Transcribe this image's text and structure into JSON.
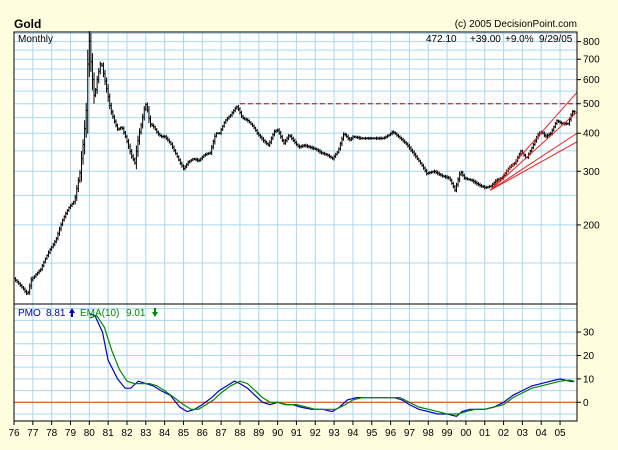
{
  "chart_data": [
    {
      "type": "bar",
      "subtype": "ohlc-monthly",
      "title": "Gold",
      "subtitle": "Monthly",
      "credit": "(c) 2005 DecisionPoint.com",
      "readout": {
        "last": "472.10",
        "change": "+39.00",
        "pct": "+9.0%",
        "date": "9/29/05"
      },
      "x_range": [
        1976,
        2005.9
      ],
      "ylim": [
        110,
        860
      ],
      "y_log": true,
      "y_ticks": [
        200,
        300,
        400,
        500,
        600,
        700,
        800
      ],
      "y_tick_labels": [
        "200",
        "300",
        "400",
        "500",
        "600",
        "700",
        "800"
      ],
      "x_tick_labels": [
        "76",
        "77",
        "78",
        "79",
        "80",
        "81",
        "82",
        "83",
        "84",
        "85",
        "86",
        "87",
        "88",
        "89",
        "90",
        "91",
        "92",
        "93",
        "94",
        "95",
        "96",
        "97",
        "98",
        "99",
        "00",
        "01",
        "02",
        "03",
        "04",
        "05"
      ],
      "grid": true,
      "price_path": [
        [
          1976.0,
          135
        ],
        [
          1976.5,
          125
        ],
        [
          1976.8,
          118
        ],
        [
          1977.0,
          132
        ],
        [
          1977.5,
          143
        ],
        [
          1977.9,
          162
        ],
        [
          1978.3,
          178
        ],
        [
          1978.7,
          210
        ],
        [
          1979.0,
          228
        ],
        [
          1979.3,
          240
        ],
        [
          1979.6,
          300
        ],
        [
          1979.8,
          390
        ],
        [
          1979.95,
          500
        ],
        [
          1980.05,
          850
        ],
        [
          1980.2,
          640
        ],
        [
          1980.35,
          520
        ],
        [
          1980.5,
          600
        ],
        [
          1980.7,
          690
        ],
        [
          1980.85,
          620
        ],
        [
          1981.0,
          560
        ],
        [
          1981.2,
          480
        ],
        [
          1981.4,
          440
        ],
        [
          1981.6,
          410
        ],
        [
          1981.8,
          420
        ],
        [
          1982.0,
          390
        ],
        [
          1982.3,
          340
        ],
        [
          1982.5,
          320
        ],
        [
          1982.7,
          390
        ],
        [
          1982.85,
          430
        ],
        [
          1983.0,
          480
        ],
        [
          1983.1,
          500
        ],
        [
          1983.3,
          430
        ],
        [
          1983.5,
          420
        ],
        [
          1983.7,
          400
        ],
        [
          1983.9,
          390
        ],
        [
          1984.1,
          390
        ],
        [
          1984.4,
          370
        ],
        [
          1984.7,
          340
        ],
        [
          1984.9,
          320
        ],
        [
          1985.1,
          305
        ],
        [
          1985.3,
          320
        ],
        [
          1985.6,
          330
        ],
        [
          1985.9,
          325
        ],
        [
          1986.2,
          340
        ],
        [
          1986.5,
          345
        ],
        [
          1986.8,
          400
        ],
        [
          1987.0,
          400
        ],
        [
          1987.3,
          440
        ],
        [
          1987.6,
          460
        ],
        [
          1987.9,
          490
        ],
        [
          1988.0,
          480
        ],
        [
          1988.2,
          450
        ],
        [
          1988.5,
          440
        ],
        [
          1988.8,
          420
        ],
        [
          1989.0,
          400
        ],
        [
          1989.3,
          380
        ],
        [
          1989.6,
          365
        ],
        [
          1989.9,
          405
        ],
        [
          1990.1,
          410
        ],
        [
          1990.4,
          370
        ],
        [
          1990.7,
          395
        ],
        [
          1990.9,
          380
        ],
        [
          1991.2,
          360
        ],
        [
          1991.5,
          365
        ],
        [
          1991.8,
          360
        ],
        [
          1992.1,
          355
        ],
        [
          1992.4,
          345
        ],
        [
          1992.7,
          340
        ],
        [
          1993.0,
          330
        ],
        [
          1993.3,
          350
        ],
        [
          1993.6,
          400
        ],
        [
          1993.9,
          380
        ],
        [
          1994.1,
          390
        ],
        [
          1994.5,
          385
        ],
        [
          1994.9,
          385
        ],
        [
          1995.3,
          385
        ],
        [
          1995.7,
          385
        ],
        [
          1996.0,
          395
        ],
        [
          1996.2,
          405
        ],
        [
          1996.6,
          385
        ],
        [
          1996.9,
          370
        ],
        [
          1997.2,
          350
        ],
        [
          1997.5,
          330
        ],
        [
          1997.8,
          310
        ],
        [
          1998.0,
          295
        ],
        [
          1998.4,
          300
        ],
        [
          1998.8,
          290
        ],
        [
          1999.2,
          285
        ],
        [
          1999.5,
          260
        ],
        [
          1999.8,
          300
        ],
        [
          2000.0,
          285
        ],
        [
          2000.4,
          280
        ],
        [
          2000.8,
          270
        ],
        [
          2001.1,
          265
        ],
        [
          2001.4,
          268
        ],
        [
          2001.7,
          280
        ],
        [
          2002.0,
          285
        ],
        [
          2002.4,
          310
        ],
        [
          2002.7,
          320
        ],
        [
          2003.0,
          350
        ],
        [
          2003.3,
          330
        ],
        [
          2003.6,
          360
        ],
        [
          2003.9,
          395
        ],
        [
          2004.1,
          405
        ],
        [
          2004.3,
          390
        ],
        [
          2004.6,
          400
        ],
        [
          2004.9,
          440
        ],
        [
          2005.2,
          430
        ],
        [
          2005.5,
          430
        ],
        [
          2005.75,
          472
        ]
      ],
      "annotations": {
        "resistance_level": 500,
        "resistance_start_x": 1988.0,
        "trendlines": [
          {
            "points": [
              [
                2001.3,
                260
              ],
              [
                2005.9,
                545
              ]
            ]
          },
          {
            "points": [
              [
                2001.3,
                260
              ],
              [
                2005.9,
                470
              ]
            ]
          },
          {
            "points": [
              [
                2001.3,
                260
              ],
              [
                2005.9,
                400
              ]
            ]
          },
          {
            "points": [
              [
                2001.3,
                260
              ],
              [
                2005.9,
                375
              ]
            ]
          }
        ]
      },
      "colors": {
        "price": "#000000",
        "resistance": "#CC0000",
        "trend": "#EE2222",
        "grid": "#A8D8F0",
        "background": "#FFFFFF"
      }
    },
    {
      "type": "line",
      "subtitle_parts": {
        "pmo": "PMO",
        "pmo_value": "8.81",
        "ema": "EMA(10)",
        "ema_value": "9.01"
      },
      "arrows": {
        "pmo": "up",
        "ema": "down"
      },
      "ylim": [
        -8,
        42
      ],
      "y_ticks": [
        0,
        10,
        20,
        30
      ],
      "y_tick_labels": [
        "0",
        "10",
        "20",
        "30"
      ],
      "zero_line": 0,
      "series": [
        {
          "name": "PMO",
          "color": "#0000CC",
          "points": [
            [
              1980.0,
              38
            ],
            [
              1980.3,
              37
            ],
            [
              1980.7,
              30
            ],
            [
              1981.0,
              18
            ],
            [
              1981.5,
              10
            ],
            [
              1981.9,
              6
            ],
            [
              1982.2,
              6
            ],
            [
              1982.6,
              9
            ],
            [
              1983.0,
              8
            ],
            [
              1983.4,
              7
            ],
            [
              1983.8,
              5
            ],
            [
              1984.3,
              3
            ],
            [
              1984.8,
              -2
            ],
            [
              1985.2,
              -4
            ],
            [
              1985.6,
              -3
            ],
            [
              1986.0,
              -1
            ],
            [
              1986.5,
              2
            ],
            [
              1986.9,
              5
            ],
            [
              1987.3,
              7
            ],
            [
              1987.7,
              9
            ],
            [
              1988.0,
              8
            ],
            [
              1988.4,
              6
            ],
            [
              1988.8,
              3
            ],
            [
              1989.2,
              0
            ],
            [
              1989.6,
              -1
            ],
            [
              1990.0,
              0
            ],
            [
              1990.4,
              -1
            ],
            [
              1990.8,
              -1
            ],
            [
              1991.2,
              -2
            ],
            [
              1991.8,
              -3
            ],
            [
              1992.4,
              -3
            ],
            [
              1992.9,
              -4
            ],
            [
              1993.3,
              -2
            ],
            [
              1993.7,
              1
            ],
            [
              1994.2,
              2
            ],
            [
              1994.7,
              2
            ],
            [
              1995.2,
              2
            ],
            [
              1995.7,
              2
            ],
            [
              1996.2,
              2
            ],
            [
              1996.6,
              1
            ],
            [
              1997.0,
              -1
            ],
            [
              1997.5,
              -3
            ],
            [
              1998.0,
              -4
            ],
            [
              1998.5,
              -5
            ],
            [
              1999.0,
              -5
            ],
            [
              1999.5,
              -6
            ],
            [
              1999.8,
              -4
            ],
            [
              2000.2,
              -3
            ],
            [
              2000.6,
              -3
            ],
            [
              2001.0,
              -3
            ],
            [
              2001.5,
              -2
            ],
            [
              2002.0,
              0
            ],
            [
              2002.5,
              3
            ],
            [
              2003.0,
              5
            ],
            [
              2003.5,
              7
            ],
            [
              2004.0,
              8
            ],
            [
              2004.5,
              9
            ],
            [
              2005.0,
              10
            ],
            [
              2005.5,
              9
            ],
            [
              2005.75,
              8.81
            ]
          ]
        },
        {
          "name": "EMA(10)",
          "color": "#008800",
          "points": [
            [
              1980.0,
              36
            ],
            [
              1980.4,
              37
            ],
            [
              1980.8,
              32
            ],
            [
              1981.2,
              22
            ],
            [
              1981.6,
              14
            ],
            [
              1982.0,
              9
            ],
            [
              1982.4,
              8
            ],
            [
              1982.8,
              8
            ],
            [
              1983.2,
              8
            ],
            [
              1983.6,
              7
            ],
            [
              1984.0,
              5
            ],
            [
              1984.5,
              2
            ],
            [
              1985.0,
              -1
            ],
            [
              1985.4,
              -3
            ],
            [
              1985.8,
              -3
            ],
            [
              1986.2,
              -1
            ],
            [
              1986.6,
              1
            ],
            [
              1987.0,
              4
            ],
            [
              1987.5,
              7
            ],
            [
              1988.0,
              9
            ],
            [
              1988.4,
              8
            ],
            [
              1988.8,
              5
            ],
            [
              1989.2,
              2
            ],
            [
              1989.6,
              0
            ],
            [
              1990.0,
              0
            ],
            [
              1990.5,
              -1
            ],
            [
              1991.0,
              -1
            ],
            [
              1991.5,
              -2
            ],
            [
              1992.0,
              -3
            ],
            [
              1992.6,
              -3
            ],
            [
              1993.1,
              -3
            ],
            [
              1993.6,
              -1
            ],
            [
              1994.0,
              1
            ],
            [
              1994.5,
              2
            ],
            [
              1995.0,
              2
            ],
            [
              1995.5,
              2
            ],
            [
              1996.0,
              2
            ],
            [
              1996.5,
              2
            ],
            [
              1997.0,
              0
            ],
            [
              1997.5,
              -2
            ],
            [
              1998.0,
              -3
            ],
            [
              1998.5,
              -4
            ],
            [
              1999.0,
              -5
            ],
            [
              1999.6,
              -5
            ],
            [
              2000.0,
              -4
            ],
            [
              2000.5,
              -3
            ],
            [
              2001.0,
              -3
            ],
            [
              2001.5,
              -2
            ],
            [
              2002.0,
              -1
            ],
            [
              2002.5,
              2
            ],
            [
              2003.0,
              4
            ],
            [
              2003.5,
              6
            ],
            [
              2004.0,
              7
            ],
            [
              2004.5,
              8
            ],
            [
              2005.0,
              9
            ],
            [
              2005.5,
              9.5
            ],
            [
              2005.75,
              9.01
            ]
          ]
        }
      ],
      "colors": {
        "zero_line": "#E04000",
        "grid": "#A8D8F0"
      }
    }
  ]
}
